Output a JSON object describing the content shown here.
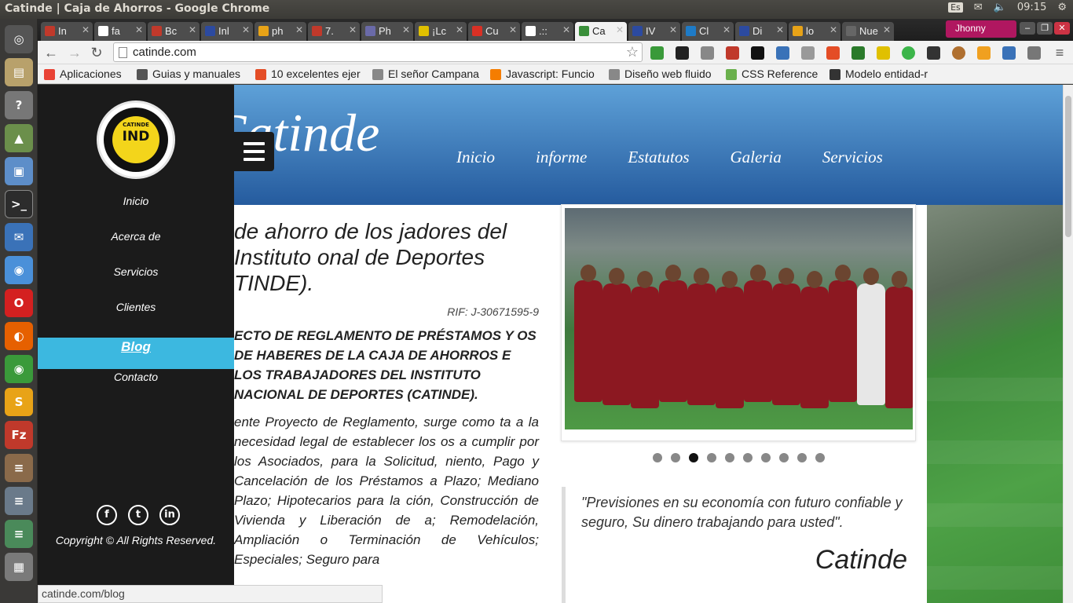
{
  "os": {
    "window_title": "Catinde | Caja de Ahorros - Google Chrome",
    "keyboard": "Es",
    "clock": "09:15"
  },
  "chrome": {
    "tabs": [
      {
        "label": "In",
        "color": "#c0392b"
      },
      {
        "label": "fa",
        "color": "#ffffff"
      },
      {
        "label": "Bc",
        "color": "#c0392b"
      },
      {
        "label": "Inl",
        "color": "#2c4aa0"
      },
      {
        "label": "ph",
        "color": "#e8a317"
      },
      {
        "label": "7.",
        "color": "#c0392b"
      },
      {
        "label": "Ph",
        "color": "#6a6aa8"
      },
      {
        "label": "¡Lc",
        "color": "#e0c000"
      },
      {
        "label": "Cu",
        "color": "#d93025"
      },
      {
        "label": ".::",
        "color": "#ffffff"
      },
      {
        "label": "Ca",
        "color": "#3a8f3a",
        "active": true
      },
      {
        "label": "IV",
        "color": "#2c4aa0"
      },
      {
        "label": "Cl",
        "color": "#1e7bc7"
      },
      {
        "label": "Di",
        "color": "#2c4aa0"
      },
      {
        "label": "lo",
        "color": "#e8a317"
      },
      {
        "label": "Nue",
        "color": "#666666"
      }
    ],
    "profile_name": "Jhonny",
    "url": "catinde.com",
    "bookmarks": [
      {
        "label": "Aplicaciones",
        "color": "#e94335"
      },
      {
        "label": "Guias y manuales",
        "color": "#555555"
      },
      {
        "label": "10 excelentes ejer",
        "color": "#e44d26"
      },
      {
        "label": "El señor Campana",
        "color": "#888888"
      },
      {
        "label": "Javascript: Funcio",
        "color": "#f57d00"
      },
      {
        "label": "Diseño web fluido",
        "color": "#888888"
      },
      {
        "label": "CSS Reference",
        "color": "#6ab04c"
      },
      {
        "label": "Modelo entidad-r",
        "color": "#333333"
      }
    ],
    "status_url": "catinde.com/blog"
  },
  "site": {
    "brand": "Catinde",
    "topnav": [
      "Inicio",
      "informe",
      "Estatutos",
      "Galeria",
      "Servicios"
    ],
    "sidebar_menu": [
      {
        "label": "Inicio"
      },
      {
        "label": "Acerca de"
      },
      {
        "label": "Servicios"
      },
      {
        "label": "Clientes"
      },
      {
        "label": "Blog",
        "active": true
      },
      {
        "label": "Contacto"
      }
    ],
    "logo_text": "IND",
    "logo_top_text": "CATINDE",
    "copyright": "Copyright © All Rights Reserved.",
    "article": {
      "title": "de ahorro de los jadores del Instituto onal de Deportes TINDE).",
      "rif": "RIF: J-30671595-9",
      "heading": "ECTO DE REGLAMENTO DE PRÉSTAMOS Y OS DE HABERES DE LA CAJA DE AHORROS E LOS TRABAJADORES DEL INSTITUTO NACIONAL DE DEPORTES (CATINDE).",
      "body": "ente Proyecto de Reglamento, surge como ta a la necesidad legal de establecer los os a cumplir por los Asociados, para la Solicitud, niento, Pago y Cancelación de los Préstamos a Plazo; Mediano Plazo; Hipotecarios para la ción, Construcción de Vivienda y Liberación de a; Remodelación, Ampliación o Terminación de Vehículos; Especiales; Seguro para"
    },
    "slider": {
      "count": 10,
      "active_index": 2
    },
    "quote": "\"Previsiones en su economía con futuro confiable y seguro, Su dinero trabajando para usted\".",
    "quote_signature": "Catinde"
  }
}
